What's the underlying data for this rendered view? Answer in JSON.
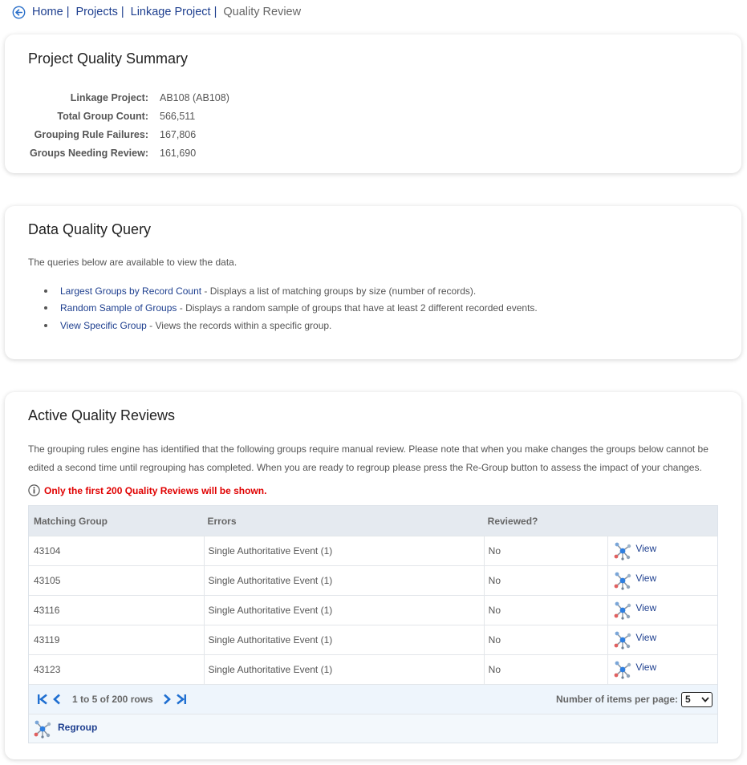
{
  "breadcrumb": {
    "items": [
      "Home",
      "Projects",
      "Linkage Project"
    ],
    "current": "Quality Review"
  },
  "summary": {
    "title": "Project Quality Summary",
    "rows": [
      {
        "label": "Linkage Project:",
        "value": "AB108 (AB108)"
      },
      {
        "label": "Total Group Count:",
        "value": "566,511"
      },
      {
        "label": "Grouping Rule Failures:",
        "value": "167,806"
      },
      {
        "label": "Groups Needing Review:",
        "value": "161,690"
      }
    ]
  },
  "query": {
    "title": "Data Quality Query",
    "intro": "The queries below are available to view the data.",
    "items": [
      {
        "link": "Largest Groups by Record Count",
        "desc": " - Displays a list of matching groups by size (number of records)."
      },
      {
        "link": "Random Sample of Groups",
        "desc": " - Displays a random sample of groups that have at least 2 different recorded events."
      },
      {
        "link": "View Specific Group",
        "desc": " - Views the records within a specific group."
      }
    ]
  },
  "reviews": {
    "title": "Active Quality Reviews",
    "description": "The grouping rules engine has identified that the following groups require manual review. Please note that when you make changes the groups below cannot be edited a second time until regrouping has completed. When you are ready to regroup please press the Re-Group button to assess the impact of your changes.",
    "notice": "Only the first 200 Quality Reviews will be shown.",
    "columns": [
      "Matching Group",
      "Errors",
      "Reviewed?"
    ],
    "rows": [
      {
        "group": "43104",
        "errors": "Single Authoritative Event (1)",
        "reviewed": "No",
        "action": "View"
      },
      {
        "group": "43105",
        "errors": "Single Authoritative Event (1)",
        "reviewed": "No",
        "action": "View"
      },
      {
        "group": "43116",
        "errors": "Single Authoritative Event (1)",
        "reviewed": "No",
        "action": "View"
      },
      {
        "group": "43119",
        "errors": "Single Authoritative Event (1)",
        "reviewed": "No",
        "action": "View"
      },
      {
        "group": "43123",
        "errors": "Single Authoritative Event (1)",
        "reviewed": "No",
        "action": "View"
      }
    ],
    "pager": {
      "info": "1 to 5 of 200 rows",
      "per_page_label": "Number of items per page:",
      "per_page_value": "5"
    },
    "regroup_label": "Regroup"
  },
  "colors": {
    "link": "#1e3f8f",
    "notice": "#e00000",
    "header_bg": "#e5eaf0",
    "pager_bg": "#eef5fc",
    "icon_blue": "#1f6fd1"
  },
  "icons": {
    "back": "circle-left-arrow-icon",
    "info": "info-circle-icon",
    "view": "molecule-network-icon",
    "pager": [
      "first-page-icon",
      "prev-page-icon",
      "next-page-icon",
      "last-page-icon"
    ]
  }
}
